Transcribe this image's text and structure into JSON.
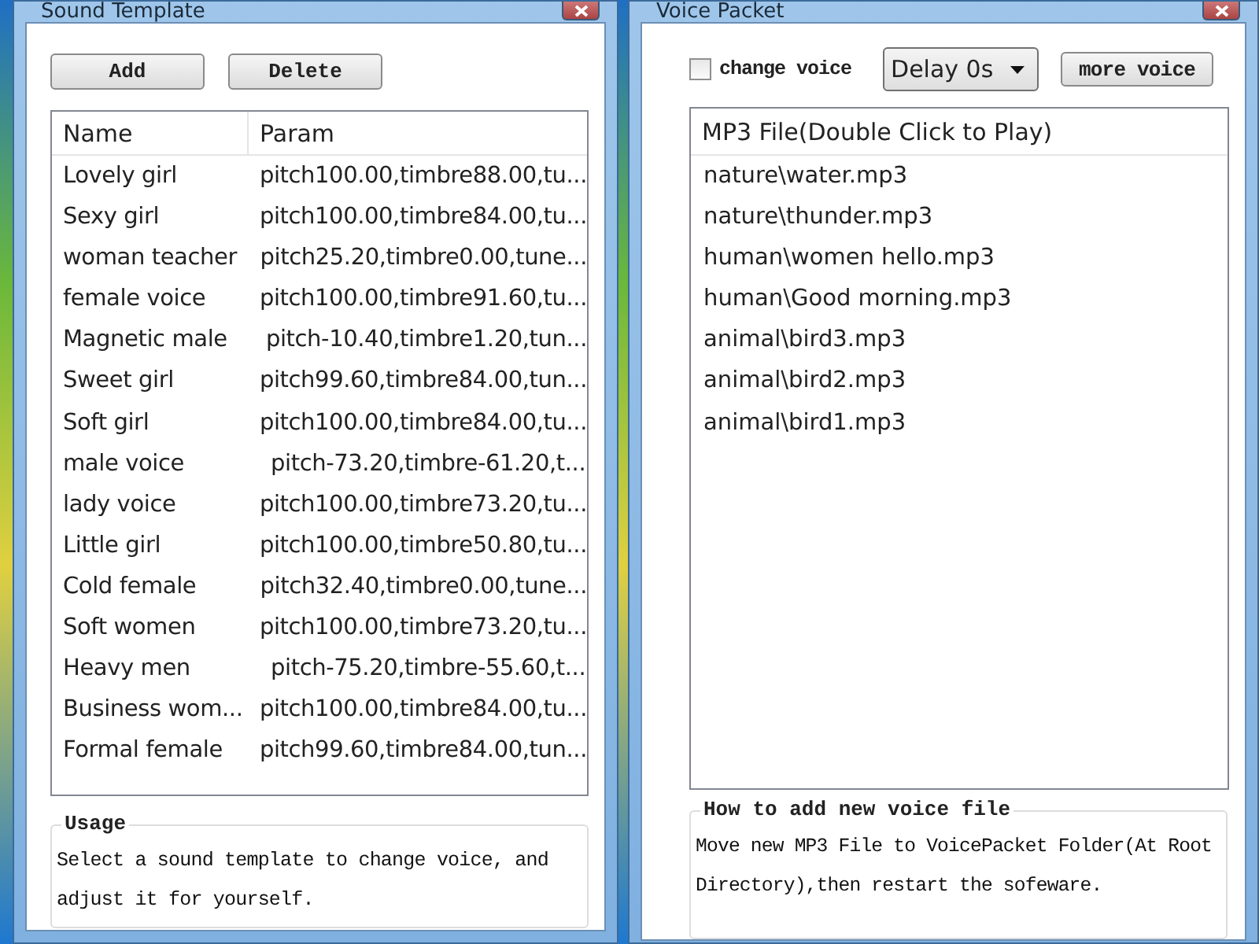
{
  "windows": [
    {
      "kind": "templates",
      "title": "Sound Template",
      "buttons": [
        "Add",
        "Delete"
      ],
      "table": {
        "columns": [
          "Name",
          "Param"
        ],
        "rows": [
          {
            "name": "Lovely girl",
            "param": "pitch100.00,timbre88.00,tu...",
            "selected": false
          },
          {
            "name": "Sexy girl",
            "param": "pitch100.00,timbre84.00,tu...",
            "selected": false
          },
          {
            "name": "woman teacher",
            "param": "pitch25.20,timbre0.00,tune...",
            "selected": false
          },
          {
            "name": "female voice",
            "param": "pitch100.00,timbre91.60,tu...",
            "selected": false
          },
          {
            "name": "Magnetic male",
            "param": "pitch-10.40,timbre1.20,tun...",
            "selected": false
          },
          {
            "name": "Sweet girl",
            "param": "pitch99.60,timbre84.00,tun...",
            "selected": false
          },
          {
            "name": "Soft girl",
            "param": "pitch100.00,timbre84.00,tu...",
            "selected": false
          },
          {
            "name": "male voice",
            "param": "pitch-73.20,timbre-61.20,t...",
            "selected": false
          },
          {
            "name": "lady voice",
            "param": "pitch100.00,timbre73.20,tu...",
            "selected": false
          },
          {
            "name": "Little girl",
            "param": "pitch100.00,timbre50.80,tu...",
            "selected": false
          },
          {
            "name": "Cold female",
            "param": "pitch32.40,timbre0.00,tune...",
            "selected": false
          },
          {
            "name": "Soft women",
            "param": "pitch100.00,timbre73.20,tu...",
            "selected": false
          },
          {
            "name": "Heavy men",
            "param": "pitch-75.20,timbre-55.60,t...",
            "selected": false
          },
          {
            "name": "Business wom...",
            "param": "pitch100.00,timbre84.00,tu...",
            "selected": false
          },
          {
            "name": "Formal female",
            "param": "pitch99.60,timbre84.00,tun...",
            "selected": false
          }
        ]
      },
      "group": {
        "title": "Usage",
        "text": "Select a sound template to change voice, and adjust it for yourself."
      }
    },
    {
      "kind": "packet",
      "title": "Voice Packet",
      "checkbox": {
        "label": "change voice",
        "checked": false
      },
      "dropdown": {
        "value": "Delay 0s"
      },
      "button": "more voice",
      "list": {
        "header": "MP3 File(Double Click to Play)",
        "items": [
          {
            "label": "nature\\water.mp3",
            "selected": false
          },
          {
            "label": "nature\\thunder.mp3",
            "selected": false
          },
          {
            "label": "human\\women hello.mp3",
            "selected": false
          },
          {
            "label": "human\\Good morning.mp3",
            "selected": false
          },
          {
            "label": "animal\\bird3.mp3",
            "selected": false
          },
          {
            "label": "animal\\bird2.mp3",
            "selected": false
          },
          {
            "label": "animal\\bird1.mp3",
            "selected": false
          }
        ]
      },
      "group": {
        "title": "How to add new voice file",
        "text": "Move new MP3 File to VoicePacket Folder(At Root Directory),then restart the sofeware."
      }
    }
  ]
}
